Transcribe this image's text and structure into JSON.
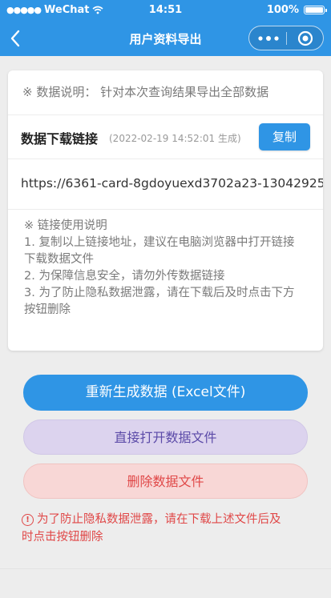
{
  "status_bar": {
    "carrier": "WeChat",
    "time": "14:51",
    "battery": "100%"
  },
  "nav": {
    "title": "用户资料导出",
    "back_icon": "chevron-left-icon",
    "more_icon": "more-dots-icon",
    "record_icon": "target-icon"
  },
  "card": {
    "description": "※ 数据说明： 针对本次查询结果导出全部数据",
    "link_title": "数据下载链接",
    "link_time": "(2022-02-19 14:52:01 生成)",
    "copy_label": "复制",
    "url": "https://6361-card-8gdoyuexd3702a23-13042925",
    "notes": [
      "※ 链接使用说明",
      "1. 复制以上链接地址，建议在电脑浏览器中打开链接",
      "下载数据文件",
      "2. 为保障信息安全，请勿外传数据链接",
      "3. 为了防止隐私数据泄露，请在下载后及时点击下方",
      "按钮删除"
    ]
  },
  "actions": {
    "regenerate_label": "重新生成数据 (Excel文件)",
    "open_label": "直接打开数据文件",
    "delete_label": "删除数据文件"
  },
  "warning": {
    "line1": "为了防止隐私数据泄露，请在下载上述文件后及",
    "line2": "时点击按钮删除"
  },
  "colors": {
    "primary": "#2f95e5",
    "open_bg": "#dcd3ee",
    "delete_bg": "#f8d7d6",
    "danger": "#e04848"
  }
}
